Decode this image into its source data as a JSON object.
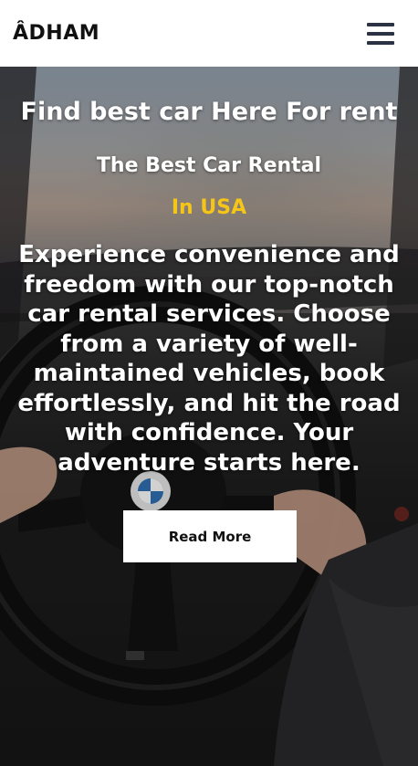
{
  "navbar": {
    "brand": "ÂDHAM",
    "menu_icon": "hamburger-menu-icon"
  },
  "hero": {
    "title": "Find best car Here For rent",
    "subtitle": "The Best Car Rental",
    "location": "In USA",
    "description": "Experience convenience and freedom with our top-notch car rental services. Choose from a variety of well-maintained vehicles, book effortlessly, and hit the road with confidence. Your adventure starts here.",
    "cta_label": "Read More",
    "background_image": "car-steering-wheel-photo"
  },
  "colors": {
    "accent": "#f5c518",
    "navbar_bg": "#ffffff",
    "icon": "#2a3244",
    "text_light": "#ffffff"
  }
}
